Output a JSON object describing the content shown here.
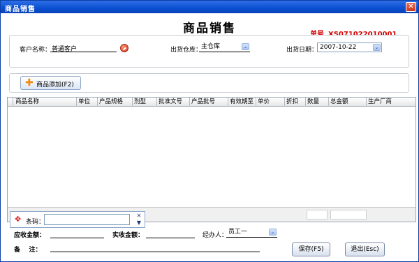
{
  "window": {
    "title": "商品销售",
    "close_label": "✕"
  },
  "header": {
    "title": "商品销售",
    "order_no_label": "单号",
    "order_no_value": "XS071022010001"
  },
  "customer": {
    "label": "客户名称：",
    "value": "普通客户",
    "lookup_icon": "search-icon"
  },
  "warehouse": {
    "label": "出货仓库：",
    "value": "主仓库"
  },
  "date": {
    "label": "出货日期：",
    "value": "2007-10-22"
  },
  "add_button": {
    "label": "商品添加(F2)",
    "icon": "plus-icon"
  },
  "grid": {
    "columns": [
      "商品名称",
      "单位",
      "产品规格",
      "剂型",
      "批准文号",
      "产品批号",
      "有效期至",
      "单价",
      "折扣",
      "数量",
      "总金额",
      "生产厂商"
    ],
    "rows": []
  },
  "barcode": {
    "label": "条码：",
    "value": "",
    "icon": "move-icon"
  },
  "summary": {
    "receivable_label": "应收金额：",
    "receivable_value": "",
    "received_label": "实收金额：",
    "received_value": "",
    "handler_label": "经办人：",
    "handler_value": "员工一",
    "remark_label": "备    注：",
    "remark_value": ""
  },
  "buttons": {
    "save": "保存(F5)",
    "exit": "退出(Esc)"
  },
  "colors": {
    "title_bar": "#0a4fd1",
    "order_no": "#d40000",
    "accent_plus": "#f08a10"
  }
}
